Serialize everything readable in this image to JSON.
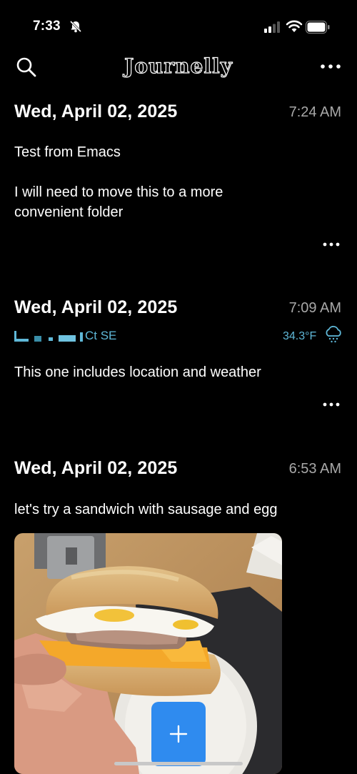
{
  "status_bar": {
    "time": "7:33"
  },
  "nav": {
    "title": "Journelly"
  },
  "entries": [
    {
      "date": "Wed, April 02, 2025",
      "time": "7:24 AM",
      "paragraphs": [
        "Test from Emacs",
        "I will need to move this to a more convenient folder"
      ]
    },
    {
      "date": "Wed, April 02, 2025",
      "time": "7:09 AM",
      "location": "Ct SE",
      "weather": "34.3°F",
      "paragraphs": [
        "This one includes location and weather"
      ]
    },
    {
      "date": "Wed, April 02, 2025",
      "time": "6:53 AM",
      "paragraphs": [
        "let's try a sandwich with sausage and egg"
      ]
    }
  ],
  "colors": {
    "accent": "#2f8bef",
    "location": "#5fb8d8",
    "time": "#a8a8a8"
  }
}
